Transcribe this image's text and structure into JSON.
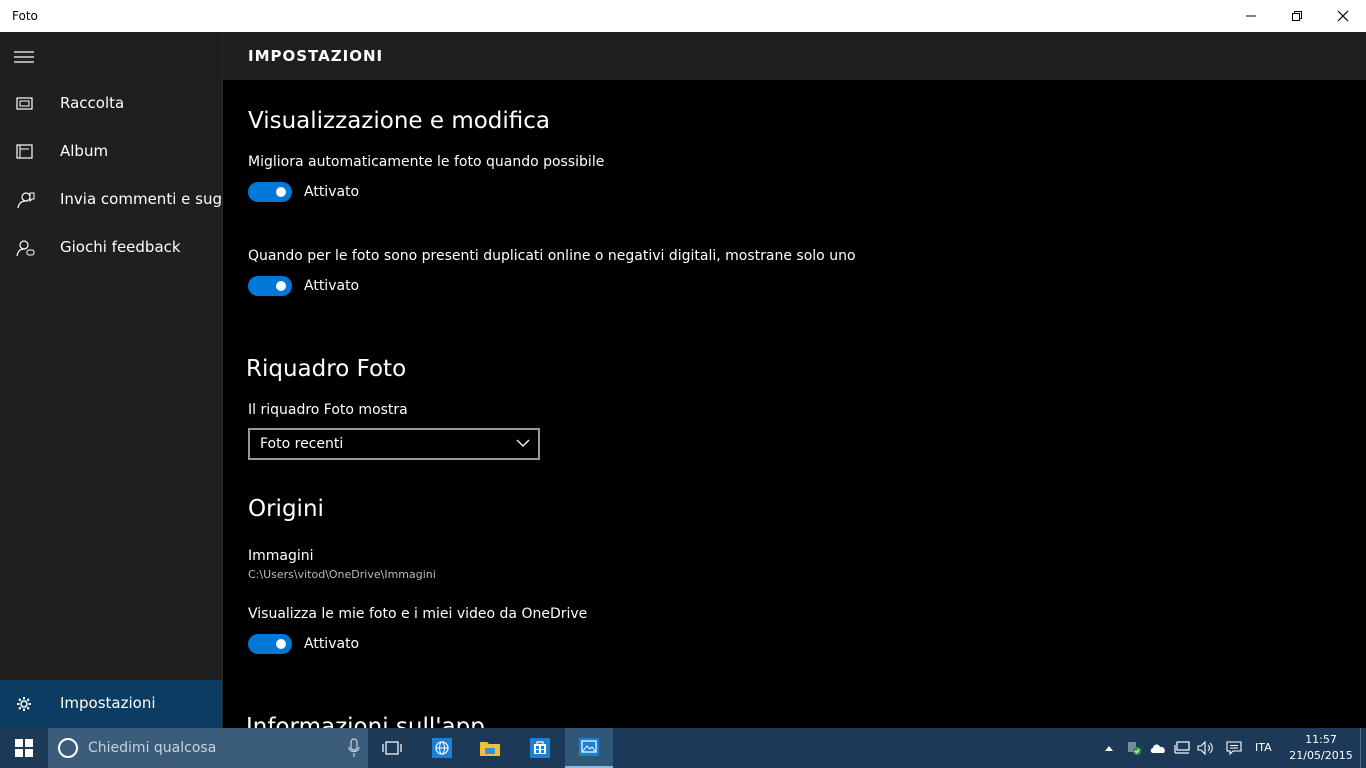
{
  "window": {
    "title": "Foto"
  },
  "sidebar": {
    "items": [
      {
        "label": "Raccolta",
        "icon": "collection-icon"
      },
      {
        "label": "Album",
        "icon": "album-icon"
      },
      {
        "label": "Invia commenti e suggerimenti",
        "icon": "feedback-icon"
      },
      {
        "label": "Giochi feedback",
        "icon": "games-feedback-icon"
      }
    ],
    "settings_label": "Impostazioni"
  },
  "header": {
    "title": "IMPOSTAZIONI"
  },
  "sections": {
    "view_edit": {
      "title": "Visualizzazione e modifica",
      "auto_enhance_label": "Migliora automaticamente le foto quando possibile",
      "auto_enhance_state": "Attivato",
      "duplicates_label": "Quando per le foto sono presenti duplicati online o negativi digitali, mostrane solo uno",
      "duplicates_state": "Attivato"
    },
    "tile": {
      "title": "Riquadro Foto",
      "label": "Il riquadro Foto mostra",
      "selected": "Foto recenti"
    },
    "sources": {
      "title": "Origini",
      "folder_name": "Immagini",
      "folder_path": "C:\\Users\\vitod\\OneDrive\\Immagini",
      "onedrive_label": "Visualizza le mie foto e i miei video da OneDrive",
      "onedrive_state": "Attivato"
    },
    "about": {
      "title": "Informazioni sull'app"
    }
  },
  "taskbar": {
    "search_placeholder": "Chiedimi qualcosa",
    "language": "ITA",
    "time": "11:57",
    "date": "21/05/2015"
  },
  "colors": {
    "accent": "#0078d7",
    "sidebar_bg": "#1f1f1f",
    "taskbar_bg": "#1c3a57",
    "selected_nav": "#0c3c61"
  }
}
